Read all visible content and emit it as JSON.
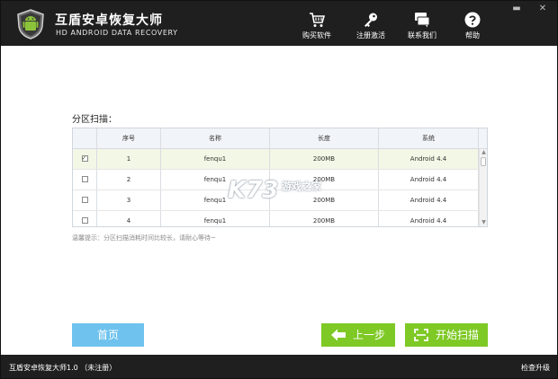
{
  "header": {
    "title": "互盾安卓恢复大师",
    "subtitle": "HD ANDROID DATA RECOVERY",
    "logo_icon": "shield-android-icon",
    "tools": [
      {
        "label": "购买软件",
        "icon": "shopping-cart-icon"
      },
      {
        "label": "注册激活",
        "icon": "key-icon"
      },
      {
        "label": "联系我们",
        "icon": "chat-icon"
      },
      {
        "label": "帮助",
        "icon": "help-icon"
      }
    ],
    "minimize": "▬",
    "close": "✕"
  },
  "main": {
    "section_title": "分区扫描：",
    "columns": [
      "",
      "序号",
      "名称",
      "长度",
      "系统"
    ],
    "rows": [
      {
        "checked": true,
        "index": "1",
        "name": "fenqu1",
        "size": "200MB",
        "system": "Android 4.4"
      },
      {
        "checked": false,
        "index": "2",
        "name": "fenqu1",
        "size": "200MB",
        "system": "Android 4.4"
      },
      {
        "checked": false,
        "index": "3",
        "name": "fenqu1",
        "size": "200MB",
        "system": "Android 4.4"
      },
      {
        "checked": false,
        "index": "4",
        "name": "fenqu1",
        "size": "200MB",
        "system": "Android 4.4"
      }
    ],
    "hint": "温馨提示：分区扫描消耗时间比较长，请耐心等待~",
    "watermark": "K73",
    "watermark_sub": "游戏之家"
  },
  "buttons": {
    "home": "首页",
    "prev": "上一步",
    "start": "开始扫描"
  },
  "status": {
    "left": "互盾安卓恢复大师1.0 （未注册）",
    "right": "检查升级"
  },
  "colors": {
    "header_bg": "#1f1f1f",
    "home_button": "#6fc2ee",
    "green_button": "#7ec925",
    "logo_green": "#8bc33a"
  }
}
